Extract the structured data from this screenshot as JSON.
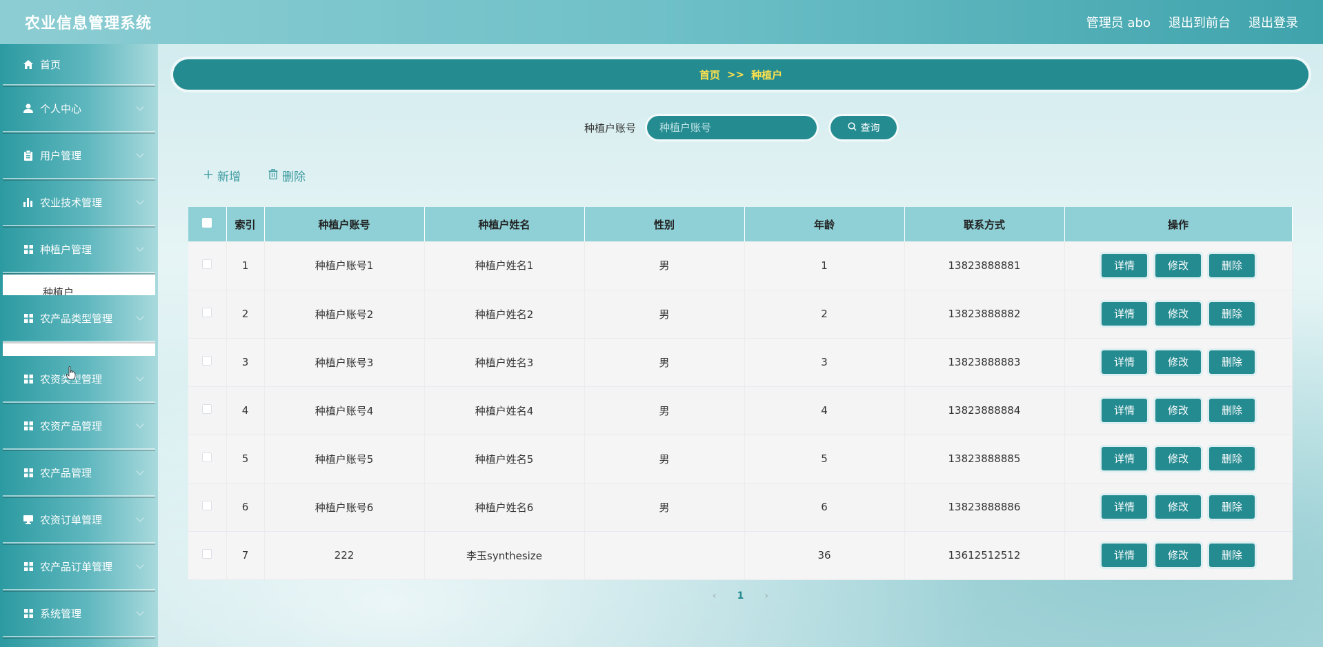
{
  "header": {
    "app_title": "农业信息管理系统",
    "user_label": "管理员 abo",
    "to_front_label": "退出到前台",
    "logout_label": "退出登录"
  },
  "sidebar": {
    "items": [
      {
        "label": "首页",
        "icon": "home-icon"
      },
      {
        "label": "个人中心",
        "icon": "user-icon"
      },
      {
        "label": "用户管理",
        "icon": "clipboard-icon"
      },
      {
        "label": "农业技术管理",
        "icon": "bar-chart-icon"
      },
      {
        "label": "种植户管理",
        "icon": "grid-icon"
      },
      {
        "label": "农产品类型管理",
        "icon": "grid-icon"
      },
      {
        "label": "农资类型管理",
        "icon": "grid-icon"
      },
      {
        "label": "农资产品管理",
        "icon": "grid-icon"
      },
      {
        "label": "农产品管理",
        "icon": "grid-icon"
      },
      {
        "label": "农资订单管理",
        "icon": "monitor-icon"
      },
      {
        "label": "农产品订单管理",
        "icon": "grid-icon"
      },
      {
        "label": "系统管理",
        "icon": "grid-icon"
      }
    ],
    "submenu_planter": "种植户"
  },
  "breadcrumb": {
    "home": "首页",
    "sep": ">>",
    "current": "种植户"
  },
  "search": {
    "label": "种植户账号",
    "placeholder": "种植户账号",
    "button_label": "查询"
  },
  "actions": {
    "add_label": "新增",
    "delete_label": "删除"
  },
  "table": {
    "columns": [
      "索引",
      "种植户账号",
      "种植户姓名",
      "性别",
      "年龄",
      "联系方式",
      "操作"
    ],
    "rows": [
      {
        "index": "1",
        "account": "种植户账号1",
        "name": "种植户姓名1",
        "gender": "男",
        "age": "1",
        "phone": "13823888881"
      },
      {
        "index": "2",
        "account": "种植户账号2",
        "name": "种植户姓名2",
        "gender": "男",
        "age": "2",
        "phone": "13823888882"
      },
      {
        "index": "3",
        "account": "种植户账号3",
        "name": "种植户姓名3",
        "gender": "男",
        "age": "3",
        "phone": "13823888883"
      },
      {
        "index": "4",
        "account": "种植户账号4",
        "name": "种植户姓名4",
        "gender": "男",
        "age": "4",
        "phone": "13823888884"
      },
      {
        "index": "5",
        "account": "种植户账号5",
        "name": "种植户姓名5",
        "gender": "男",
        "age": "5",
        "phone": "13823888885"
      },
      {
        "index": "6",
        "account": "种植户账号6",
        "name": "种植户姓名6",
        "gender": "男",
        "age": "6",
        "phone": "13823888886"
      },
      {
        "index": "7",
        "account": "222",
        "name": "李玉synthesize",
        "gender": "",
        "age": "36",
        "phone": "13612512512"
      }
    ],
    "op_labels": {
      "detail": "详情",
      "edit": "修改",
      "delete": "删除"
    }
  },
  "pager": {
    "prev": "‹",
    "current": "1",
    "next": "›"
  },
  "colors": {
    "primary": "#248b91",
    "header_bg": "#8ed0d6",
    "breadcrumb_text": "#ffe14d"
  }
}
